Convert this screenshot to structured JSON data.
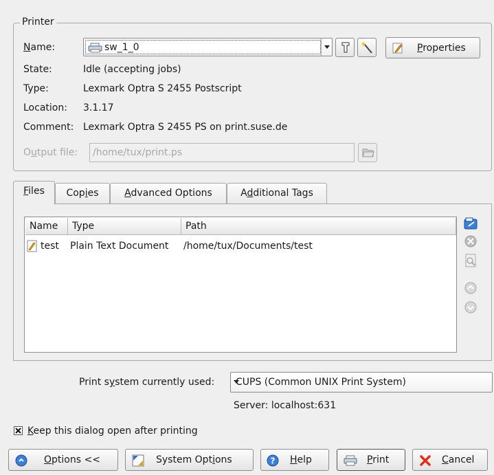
{
  "printer": {
    "group_title": "Printer",
    "name_label": "Name:",
    "name_value": "sw_1_0",
    "properties_label": "Properties",
    "state_label": "State:",
    "state_value": "Idle (accepting jobs)",
    "type_label": "Type:",
    "type_value": "Lexmark Optra S 2455 Postscript",
    "location_label": "Location:",
    "location_value": "3.1.17",
    "comment_label": "Comment:",
    "comment_value": "Lexmark Optra S 2455 PS on print.suse.de",
    "output_file_label": "Output file:",
    "output_file_value": "/home/tux/print.ps"
  },
  "tabs": [
    {
      "label": "Files",
      "active": true
    },
    {
      "label": "Copies",
      "active": false
    },
    {
      "label": "Advanced Options",
      "active": false
    },
    {
      "label": "Additional Tags",
      "active": false
    }
  ],
  "files": {
    "columns": [
      "Name",
      "Type",
      "Path"
    ],
    "rows": [
      {
        "name": "test",
        "type": "Plain Text Document",
        "path": "/home/tux/Documents/test",
        "icon": "text-document-icon"
      }
    ],
    "side_buttons": [
      "add-file-icon",
      "remove-file-icon",
      "open-file-icon",
      "move-up-icon",
      "move-down-icon"
    ]
  },
  "print_system": {
    "label": "Print system currently used:",
    "value": "CUPS (Common UNIX Print System)",
    "server": "Server: localhost:631"
  },
  "keep_open": {
    "label": "Keep this dialog open after printing",
    "checked": true
  },
  "buttons": {
    "options": "Options <<",
    "system_options": "System Options",
    "help": "Help",
    "print": "Print",
    "cancel": "Cancel"
  }
}
